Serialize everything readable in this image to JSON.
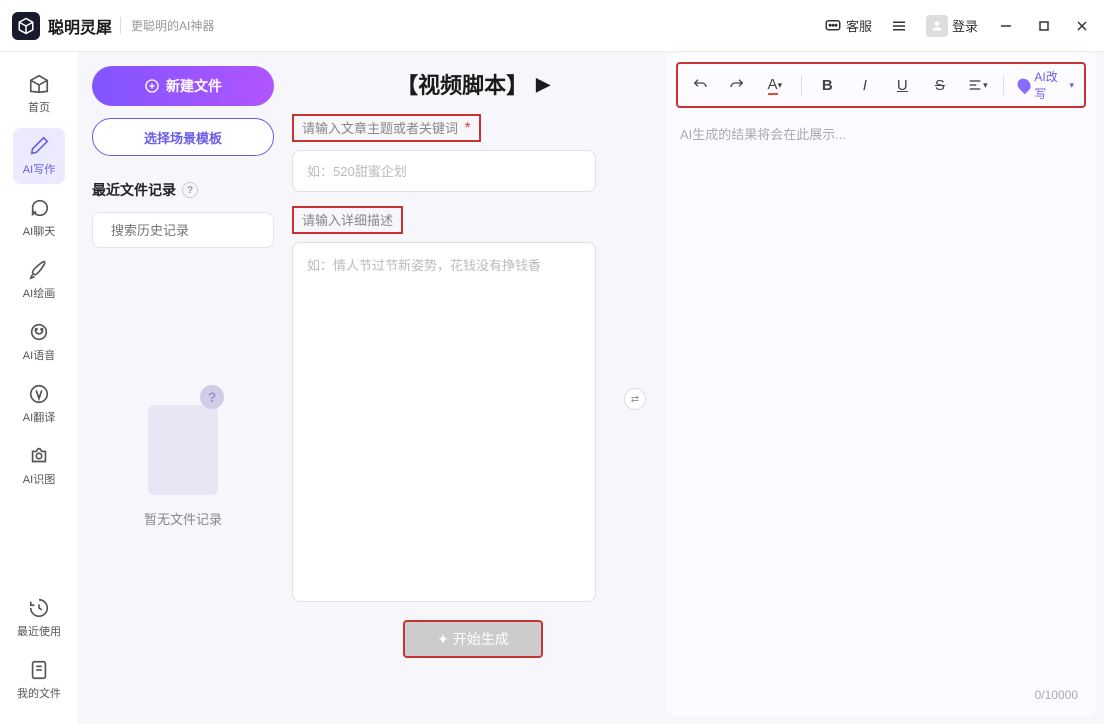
{
  "titlebar": {
    "brand": "聪明灵犀",
    "tagline": "更聪明的AI神器",
    "service": "客服",
    "login": "登录"
  },
  "sidebar": {
    "items": [
      {
        "label": "首页"
      },
      {
        "label": "AI写作"
      },
      {
        "label": "AI聊天"
      },
      {
        "label": "AI绘画"
      },
      {
        "label": "AI语音"
      },
      {
        "label": "AI翻译"
      },
      {
        "label": "AI识图"
      }
    ],
    "bottom": [
      {
        "label": "最近使用"
      },
      {
        "label": "我的文件"
      }
    ]
  },
  "panel": {
    "new_file": "新建文件",
    "template": "选择场景模板",
    "recent_title": "最近文件记录",
    "search_placeholder": "搜索历史记录",
    "empty": "暂无文件记录"
  },
  "center": {
    "title": "【视频脚本】",
    "label1": "请输入文章主题或者关键词",
    "req": "*",
    "placeholder1": "如：520甜蜜企划",
    "label2": "请输入详细描述",
    "placeholder2": "如：情人节过节新姿势，花钱没有挣钱香",
    "generate": "开始生成"
  },
  "right": {
    "rewrite": "AI改写",
    "output_placeholder": "AI生成的结果将会在此展示...",
    "char_count": "0/10000",
    "tools": {
      "font": "A",
      "bold": "B",
      "italic": "I",
      "underline": "U",
      "strike": "S"
    }
  }
}
